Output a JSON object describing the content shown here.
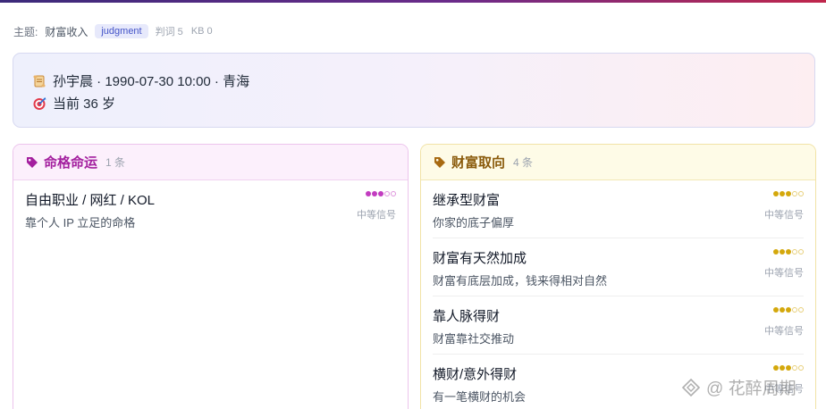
{
  "meta": {
    "theme_label": "主题:",
    "theme_value": "财富收入",
    "mode_tag": "judgment",
    "judgment_count": "判词 5",
    "kb_count": "KB 0"
  },
  "profile": {
    "line1": "孙宇晨 · 1990-07-30 10:00 · 青海",
    "line1_icon": "scroll-icon",
    "line2": "当前 36 岁",
    "line2_icon": "target-icon"
  },
  "cards": [
    {
      "title": "命格命运",
      "count": "1 条",
      "icon": "tag-icon",
      "accent": "#c23cc0",
      "items": [
        {
          "name": "自由职业 / 网红 / KOL",
          "desc": "靠个人 IP 立足的命格",
          "level": 3,
          "max": 5,
          "strength": "中等信号"
        }
      ]
    },
    {
      "title": "财富取向",
      "count": "4 条",
      "icon": "tag-icon",
      "accent": "#d4a80c",
      "items": [
        {
          "name": "继承型财富",
          "desc": "你家的底子偏厚",
          "level": 3,
          "max": 5,
          "strength": "中等信号"
        },
        {
          "name": "财富有天然加成",
          "desc": "财富有底层加成，钱来得相对自然",
          "level": 3,
          "max": 5,
          "strength": "中等信号"
        },
        {
          "name": "靠人脉得财",
          "desc": "财富靠社交推动",
          "level": 3,
          "max": 5,
          "strength": "中等信号"
        },
        {
          "name": "横财/意外得财",
          "desc": "有一笔横财的机会",
          "level": 3,
          "max": 5,
          "strength": "中等信号"
        }
      ]
    }
  ],
  "watermark": {
    "text": "@ 花醉周期"
  },
  "colors": {
    "left_accent": "#a31f9e",
    "right_accent": "#8a5a0b",
    "tag_pill_bg": "#e7e9fb",
    "tag_pill_text": "#4454c8"
  }
}
